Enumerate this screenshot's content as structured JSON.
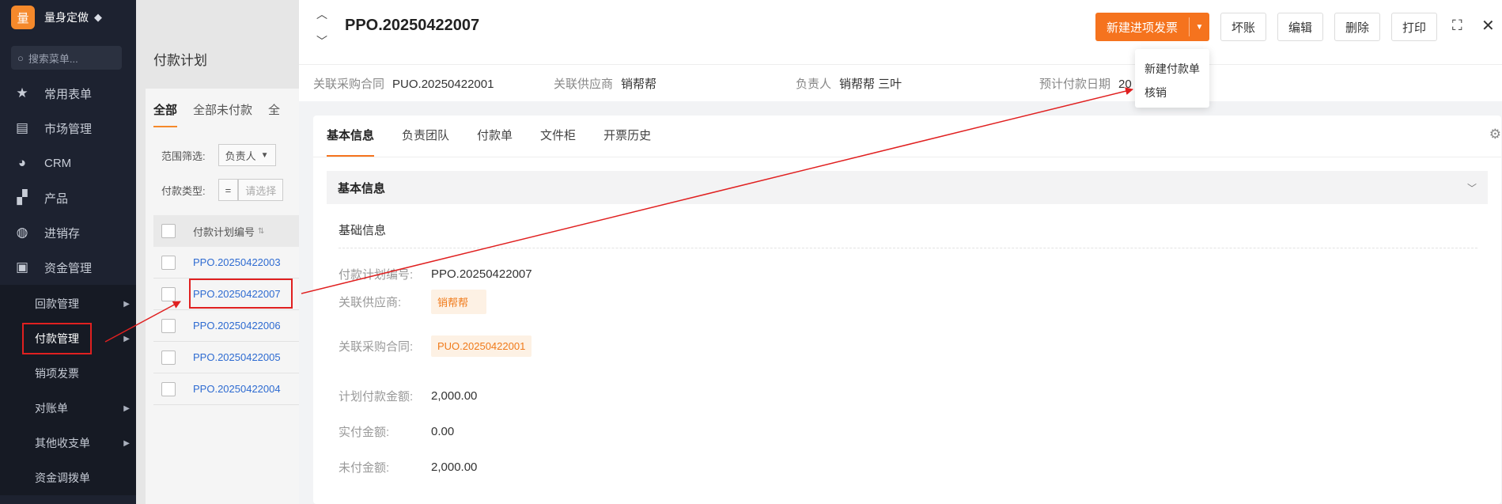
{
  "sidebar": {
    "logo_char": "量",
    "brand": "量身定做",
    "search_placeholder": "搜索菜单...",
    "items": [
      {
        "label": "常用表单"
      },
      {
        "label": "市场管理"
      },
      {
        "label": "CRM"
      },
      {
        "label": "产品"
      },
      {
        "label": "进销存"
      },
      {
        "label": "资金管理"
      }
    ],
    "subitems": [
      {
        "label": "回款管理"
      },
      {
        "label": "付款管理"
      },
      {
        "label": "销项发票"
      },
      {
        "label": "对账单"
      },
      {
        "label": "其他收支单"
      },
      {
        "label": "资金调拨单"
      }
    ]
  },
  "list_page": {
    "title": "付款计划",
    "tabs": [
      "全部",
      "全部未付款",
      "全"
    ],
    "filter_scope_label": "范围筛选:",
    "filter_scope_value": "负责人",
    "filter_type_label": "付款类型:",
    "filter_type_op": "=",
    "filter_type_placeholder": "请选择",
    "column_header": "付款计划编号",
    "rows": [
      "PPO.20250422003",
      "PPO.20250422007",
      "PPO.20250422006",
      "PPO.20250422005",
      "PPO.20250422004"
    ]
  },
  "detail": {
    "title": "PPO.20250422007",
    "primary_button": "新建进项发票",
    "buttons": {
      "bad_debt": "坏账",
      "edit": "编辑",
      "delete": "删除",
      "print": "打印"
    },
    "dropdown": [
      "新建付款单",
      "核销"
    ],
    "info": {
      "contract_label": "关联采购合同",
      "contract_value": "PUO.20250422001",
      "supplier_label": "关联供应商",
      "supplier_value": "销帮帮",
      "owner_label": "负责人",
      "owner_value": "销帮帮 三叶",
      "date_label": "预计付款日期",
      "date_value": "20"
    },
    "tabs": [
      "基本信息",
      "负责团队",
      "付款单",
      "文件柜",
      "开票历史"
    ],
    "section_title": "基本信息",
    "subsection_title": "基础信息",
    "fields": {
      "plan_no_label": "付款计划编号:",
      "plan_no_value": "PPO.20250422007",
      "supplier_label": "关联供应商:",
      "supplier_value": "销帮帮",
      "contract_label": "关联采购合同:",
      "contract_value": "PUO.20250422001",
      "planned_label": "计划付款金额:",
      "planned_value": "2,000.00",
      "paid_label": "实付金额:",
      "paid_value": "0.00",
      "unpaid_label": "未付金额:",
      "unpaid_value": "2,000.00"
    }
  },
  "colors": {
    "accent": "#f5731e",
    "annotation": "#e02020",
    "link": "#2e6bd1",
    "sidebar_bg": "#1d2230"
  }
}
